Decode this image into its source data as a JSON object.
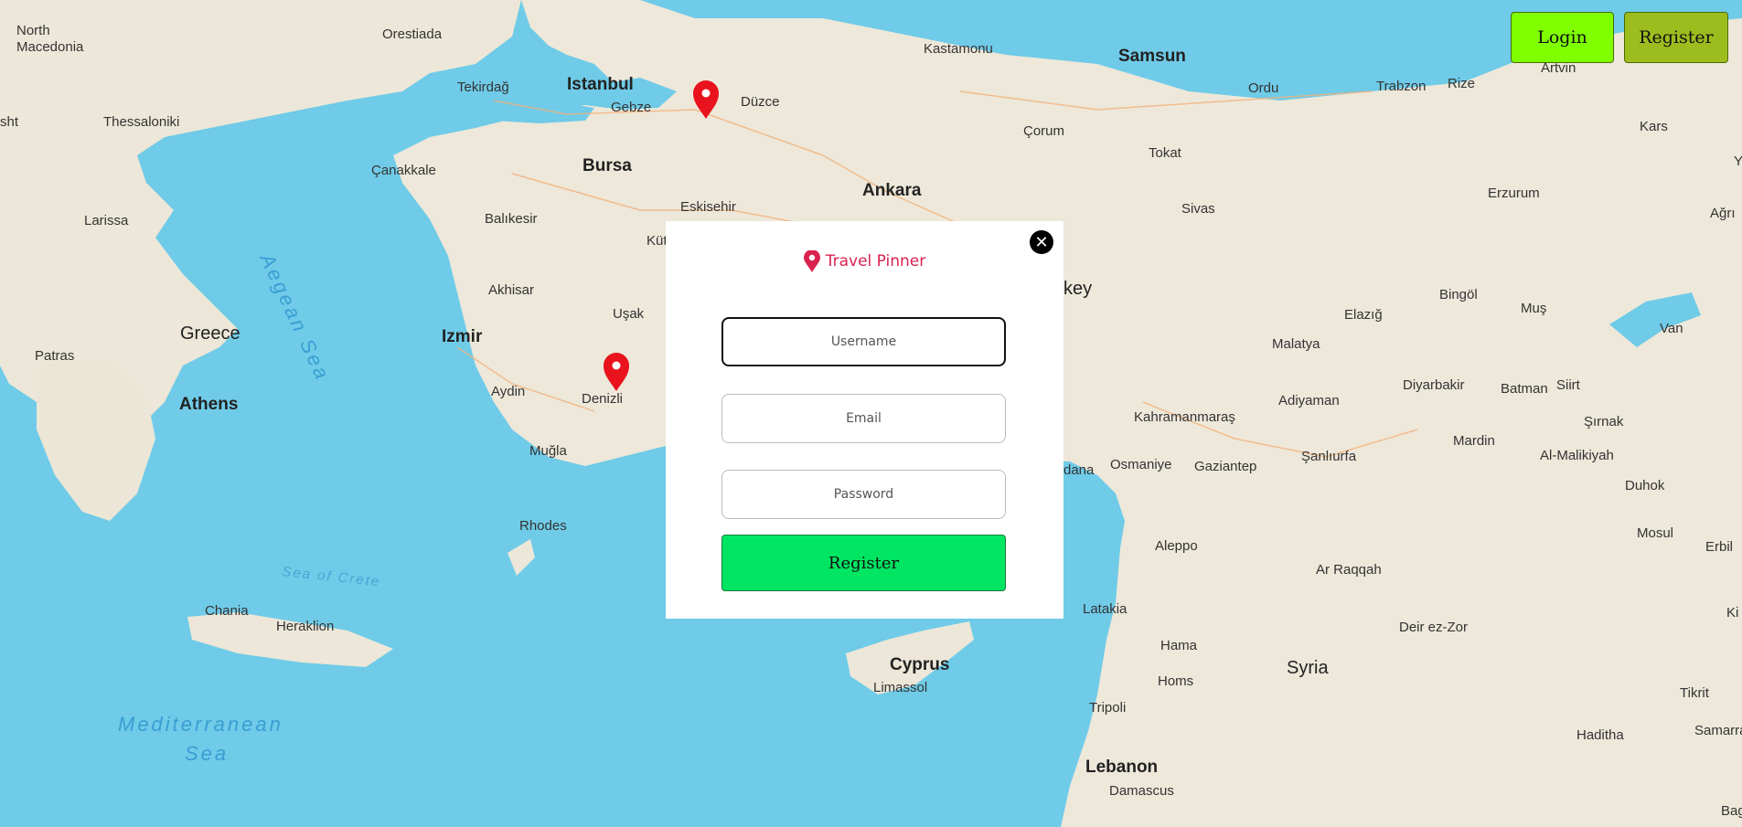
{
  "header": {
    "login_label": "Login",
    "register_label": "Register"
  },
  "modal": {
    "brand_title": "Travel Pinner",
    "username_placeholder": "Username",
    "email_placeholder": "Email",
    "password_placeholder": "Password",
    "submit_label": "Register",
    "close_icon": "close-icon",
    "brand_icon": "map-pin-icon"
  },
  "map": {
    "labels": {
      "north_macedonia_1": "North",
      "north_macedonia_2": "Macedonia",
      "orestiada": "Orestiada",
      "tekirdag": "Tekirdağ",
      "istanbul": "Istanbul",
      "gebze": "Gebze",
      "duzce": "Düzce",
      "kastamonu": "Kastamonu",
      "samsun": "Samsun",
      "ordu": "Ordu",
      "trabzon": "Trabzon",
      "rize": "Rize",
      "artvin": "Artvin",
      "thessaloniki": "Thessaloniki",
      "canakkale": "Çanakkale",
      "bursa": "Bursa",
      "corum": "Çorum",
      "tokat": "Tokat",
      "kars": "Kars",
      "larissa": "Larissa",
      "balikesir": "Balıkesir",
      "eskisehir": "Eskisehir",
      "ankara": "Ankara",
      "sivas": "Sivas",
      "erzurum": "Erzurum",
      "agri": "Ağrı",
      "aegean_sea": "Aegean Sea",
      "akhisar": "Akhisar",
      "usak": "Uşak",
      "kutahya_partial": "Küt",
      "turkey_partial": "key",
      "elazig": "Elazığ",
      "bingol": "Bingöl",
      "mus": "Muş",
      "van": "Van",
      "greece": "Greece",
      "izmir": "Izmir",
      "patras": "Patras",
      "athens": "Athens",
      "aydin": "Aydin",
      "denizli": "Denizli",
      "malatya": "Malatya",
      "adiyaman": "Adiyaman",
      "diyarbakir": "Diyarbakir",
      "batman": "Batman",
      "siirt": "Siirt",
      "sirnak": "Şırnak",
      "kahramanmaras": "Kahramanmaraş",
      "mugla": "Muğla",
      "osmaniye": "Osmaniye",
      "gaziantep": "Gaziantep",
      "sanliurfa": "Şanlıurfa",
      "mardin": "Mardin",
      "al_malikiyah": "Al-Malikiyah",
      "adana_partial": "dana",
      "duhok": "Duhok",
      "rhodes": "Rhodes",
      "aleppo": "Aleppo",
      "ar_raqqah": "Ar Raqqah",
      "mosul": "Mosul",
      "erbil": "Erbil",
      "sea_of_crete": "Sea of Crete",
      "latakia": "Latakia",
      "chania": "Chania",
      "heraklion": "Heraklion",
      "deir_ez_zor": "Deir ez-Zor",
      "hama": "Hama",
      "cyprus": "Cyprus",
      "syria": "Syria",
      "limassol": "Limassol",
      "homs": "Homs",
      "tripoli": "Tripoli",
      "tikrit": "Tikrit",
      "samarra": "Samarra",
      "mediterranean_1": "Mediterranean",
      "mediterranean_2": "Sea",
      "haditha": "Haditha",
      "lebanon": "Lebanon",
      "damascus": "Damascus",
      "baghdad_partial": "Bag",
      "ki_partial": "Ki",
      "sht_partial": "sht",
      "y_partial": "Y"
    },
    "colors": {
      "sea": "#6fcbe8",
      "land": "#efeadd",
      "pin": "#e8131c"
    }
  }
}
